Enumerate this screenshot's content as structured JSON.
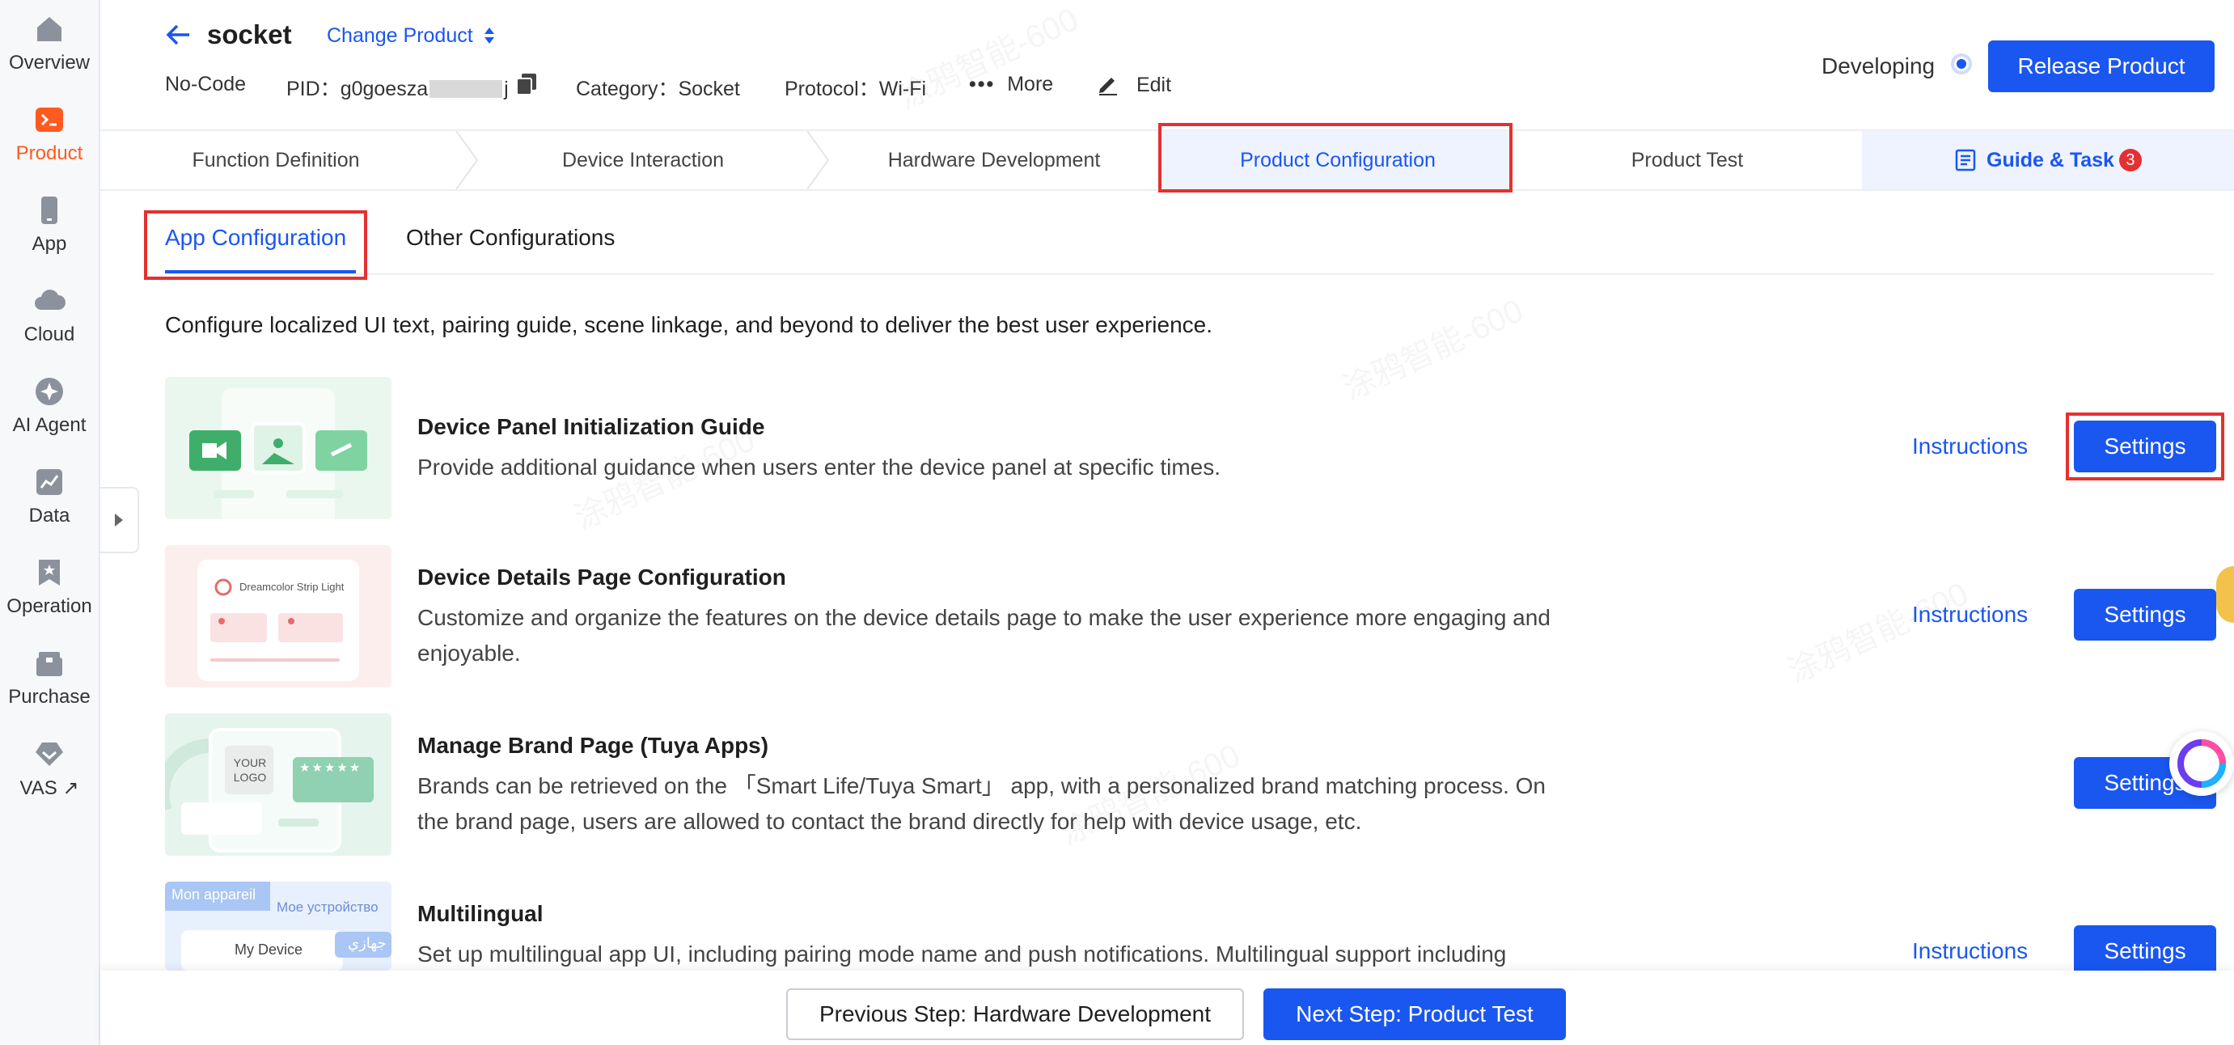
{
  "nav": {
    "items": [
      {
        "label": "Overview",
        "icon": "home-icon"
      },
      {
        "label": "Product",
        "icon": "terminal-icon"
      },
      {
        "label": "App",
        "icon": "phone-icon"
      },
      {
        "label": "Cloud",
        "icon": "cloud-icon"
      },
      {
        "label": "AI Agent",
        "icon": "sparkle-icon"
      },
      {
        "label": "Data",
        "icon": "chart-icon"
      },
      {
        "label": "Operation",
        "icon": "bookmark-icon"
      },
      {
        "label": "Purchase",
        "icon": "box-icon"
      },
      {
        "label": "VAS",
        "icon": "diamond-icon"
      }
    ],
    "vas_arrow": "↗",
    "active_color": "#ff5a1f"
  },
  "header": {
    "title": "socket",
    "change_product": "Change Product",
    "no_code": "No-Code",
    "pid_label": "PID：",
    "pid_value": "g0goesza",
    "pid_tail": "j",
    "category_label": "Category：",
    "category_value": "Socket",
    "protocol_label": "Protocol：",
    "protocol_value": "Wi-Fi",
    "more": "More",
    "edit": "Edit",
    "status": "Developing",
    "release": "Release Product"
  },
  "steps": {
    "items": [
      "Function Definition",
      "Device Interaction",
      "Hardware Development",
      "Product Configuration",
      "Product Test"
    ],
    "guide": "Guide & Task",
    "guide_badge": "3"
  },
  "subtabs": {
    "app": "App Configuration",
    "other": "Other Configurations"
  },
  "intro": "Configure localized UI text, pairing guide, scene linkage, and beyond to deliver the best user experience.",
  "rows": [
    {
      "title": "Device Panel Initialization Guide",
      "desc": "Provide additional guidance when users enter the device panel at specific times.",
      "instructions": "Instructions",
      "settings": "Settings"
    },
    {
      "title": "Device Details Page Configuration",
      "desc": "Customize and organize the features on the device details page to make the user experience more engaging and enjoyable.",
      "instructions": "Instructions",
      "settings": "Settings",
      "thumb_text": "Dreamcolor Strip Light"
    },
    {
      "title": "Manage Brand Page (Tuya Apps)",
      "desc": "Brands can be retrieved on the 「Smart Life/Tuya Smart」 app, with a personalized brand matching process. On the brand page, users are allowed to contact the brand directly for help with device usage, etc.",
      "settings": "Settings",
      "thumb_logo_1": "YOUR",
      "thumb_logo_2": "LOGO",
      "thumb_stars": "★★★★★"
    },
    {
      "title": "Multilingual",
      "desc": "Set up multilingual app UI, including pairing mode name and push notifications. Multilingual support including",
      "instructions": "Instructions",
      "settings": "Settings",
      "thumb_fr": "Mon appareil",
      "thumb_ru": "Мое устройство",
      "thumb_en": "My Device",
      "thumb_ar": "جهازي"
    }
  ],
  "footer": {
    "prev": "Previous Step: Hardware Development",
    "next": "Next Step: Product Test"
  },
  "colors": {
    "primary": "#1a56f0",
    "highlight_box": "#e53030"
  }
}
